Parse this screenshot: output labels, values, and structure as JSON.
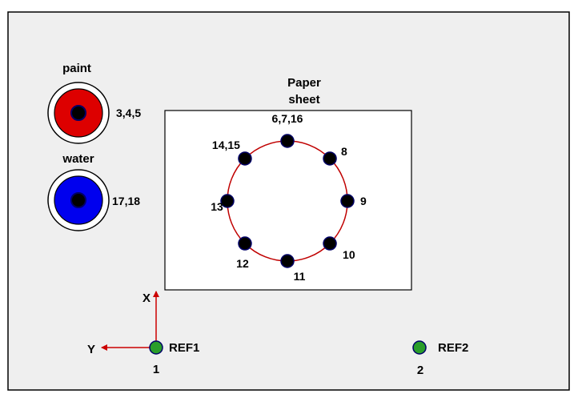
{
  "colors": {
    "workspace_bg": "#efefef",
    "workspace_border": "#000000",
    "paper_bg": "#ffffff",
    "circle_line": "#c00000",
    "point_fill": "#000000",
    "point_ring": "#000066",
    "paint_fill": "#dd0000",
    "water_fill": "#0000ee",
    "ref_fill": "#2a9d2a",
    "axis_arrow": "#cc0000"
  },
  "labels": {
    "paint": "paint",
    "paint_ids": "3,4,5",
    "water": "water",
    "water_ids": "17,18",
    "paper_line1": "Paper",
    "paper_line2": "sheet",
    "axis_x": "X",
    "axis_y": "Y",
    "ref1": "REF1",
    "ref1_id": "1",
    "ref2": "REF2",
    "ref2_id": "2"
  },
  "points": [
    {
      "label": "6,7,16"
    },
    {
      "label": "8"
    },
    {
      "label": "9"
    },
    {
      "label": "10"
    },
    {
      "label": "11"
    },
    {
      "label": "12"
    },
    {
      "label": "13"
    },
    {
      "label": "14,15"
    }
  ]
}
